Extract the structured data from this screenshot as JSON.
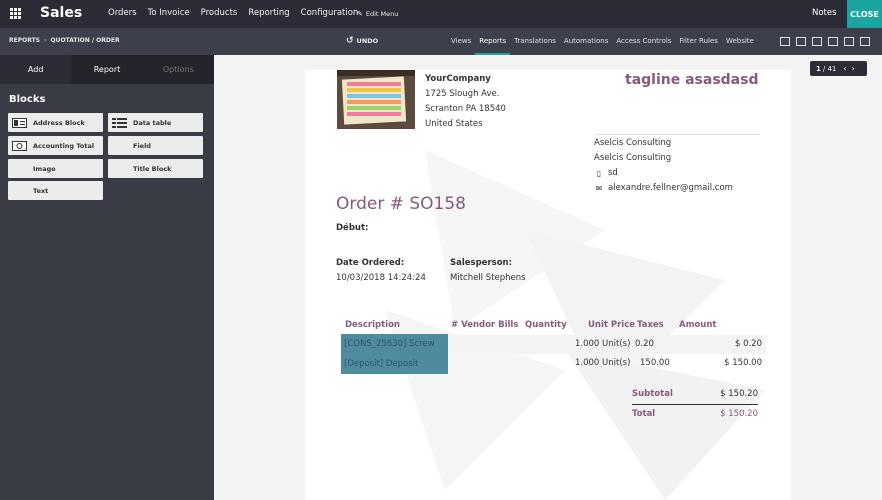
{
  "topbar": {
    "brand": "Sales",
    "menu": [
      "Orders",
      "To Invoice",
      "Products",
      "Reporting",
      "Configuration"
    ],
    "edit_menu": "Edit Menu",
    "notes": "Notes",
    "close": "CLOSE"
  },
  "subbar": {
    "breadcrumb": [
      "REPORTS",
      "QUOTATION / ORDER"
    ],
    "undo": "UNDO",
    "tabs": [
      "Views",
      "Reports",
      "Translations",
      "Automations",
      "Access Controls",
      "Filter Rules",
      "Website"
    ],
    "active_tab": "Reports",
    "accent_color": "#1aa5a0"
  },
  "sidebar": {
    "tabs": [
      "Add",
      "Report",
      "Options"
    ],
    "blocks_title": "Blocks",
    "blocks": [
      {
        "label": "Address Block",
        "icon": "address-card-icon"
      },
      {
        "label": "Data table",
        "icon": "table-icon"
      },
      {
        "label": "Accounting Total",
        "icon": "money-icon"
      },
      {
        "label": "Field",
        "icon": ""
      },
      {
        "label": "Image",
        "icon": ""
      },
      {
        "label": "Title Block",
        "icon": ""
      },
      {
        "label": "Text",
        "icon": ""
      }
    ]
  },
  "pager": {
    "current": "1",
    "total": "/ 41"
  },
  "report": {
    "company": {
      "name": "YourCompany",
      "street": "1725 Slough Ave.",
      "city": "Scranton PA 18540",
      "country": "United States"
    },
    "tagline": "tagline asasdasd",
    "customer": {
      "line1": "Aselcis Consulting",
      "line2": "Aselcis Consulting",
      "phone": "sd",
      "email": "alexandre.fellner@gmail.com"
    },
    "order_title": "Order # SO158",
    "debut": "Début:",
    "date_label": "Date Ordered:",
    "date_value": "10/03/2018 14:24:24",
    "salesperson_label": "Salesperson:",
    "salesperson_value": "Mitchell Stephens",
    "columns": [
      "Description",
      "# Vendor Bills",
      "Quantity",
      "Unit Price",
      "Taxes",
      "Amount"
    ],
    "rows": [
      {
        "description": "[CONS_25630] Screw",
        "quantity": "1.000 Unit(s)",
        "unit_price": "",
        "taxes": "0.20",
        "amount": "$ 0.20"
      },
      {
        "description": "[Deposit] Deposit",
        "quantity": "1.000 Unit(s)",
        "unit_price": "",
        "taxes": "150.00",
        "amount": "$ 150.00"
      }
    ],
    "subtotal_label": "Subtotal",
    "subtotal_value": "$ 150.20",
    "total_label": "Total",
    "total_value": "$ 150.20",
    "accent_color": "#875a7b"
  }
}
